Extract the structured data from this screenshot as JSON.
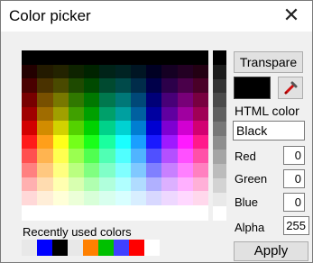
{
  "dialog": {
    "title": "Color picker",
    "close_glyph": "✕"
  },
  "palette": {
    "rows": [
      [
        "#000000",
        "#000000",
        "#000000",
        "#000000",
        "#000000",
        "#000000",
        "#000000",
        "#000000",
        "#000000",
        "#000000",
        "#000000",
        "#000000"
      ],
      [
        "#230000",
        "#231a00",
        "#232300",
        "#0e2300",
        "#002300",
        "#002318",
        "#002323",
        "#001523",
        "#000023",
        "#150023",
        "#230023",
        "#230013"
      ],
      [
        "#4a0000",
        "#4a3200",
        "#4a4a00",
        "#1e4a00",
        "#004a00",
        "#004a30",
        "#004a4a",
        "#002c4a",
        "#00004a",
        "#2c004a",
        "#4a004a",
        "#4a0028"
      ],
      [
        "#780000",
        "#785000",
        "#787800",
        "#307800",
        "#007800",
        "#00784e",
        "#007878",
        "#004878",
        "#000078",
        "#480078",
        "#780078",
        "#780040"
      ],
      [
        "#a00000",
        "#a06c00",
        "#a0a000",
        "#40a000",
        "#00a000",
        "#00a06a",
        "#00a0a0",
        "#0060a0",
        "#0000a0",
        "#6000a0",
        "#a000a0",
        "#a00056"
      ],
      [
        "#d20000",
        "#d28c00",
        "#d2d200",
        "#54d200",
        "#00d200",
        "#00d28a",
        "#00d2d2",
        "#007ed2",
        "#0000d2",
        "#7e00d2",
        "#d200d2",
        "#d20072"
      ],
      [
        "#ff1a1a",
        "#ff9f1a",
        "#ffff1a",
        "#74ff1a",
        "#1aff1a",
        "#1aff9f",
        "#1affff",
        "#1a9fff",
        "#1a1aff",
        "#9f1aff",
        "#ff1aff",
        "#ff1a8c"
      ],
      [
        "#ff5050",
        "#ffb450",
        "#ffff50",
        "#9aff50",
        "#50ff50",
        "#50ffb4",
        "#50ffff",
        "#50b4ff",
        "#5050ff",
        "#b450ff",
        "#ff50ff",
        "#ff50a8"
      ],
      [
        "#ff8080",
        "#ffc880",
        "#ffff80",
        "#baff80",
        "#80ff80",
        "#80ffc8",
        "#80ffff",
        "#80c8ff",
        "#8080ff",
        "#c880ff",
        "#ff80ff",
        "#ff80c0"
      ],
      [
        "#ffb0b0",
        "#ffdcb0",
        "#ffffb0",
        "#d8ffb0",
        "#b0ffb0",
        "#b0ffdc",
        "#b0ffff",
        "#b0dcff",
        "#b0b0ff",
        "#dcb0ff",
        "#ffb0ff",
        "#ffb0d8"
      ],
      [
        "#ffd8d8",
        "#ffeed8",
        "#ffffd8",
        "#ecffd8",
        "#d8ffd8",
        "#d8ffee",
        "#d8ffff",
        "#d8eeff",
        "#d8d8ff",
        "#eed8ff",
        "#ffd8ff",
        "#ffd8ec"
      ]
    ],
    "grays": [
      "#000000",
      "#1c1c1c",
      "#333333",
      "#4a4a4a",
      "#606060",
      "#777777",
      "#8e8e8e",
      "#a5a5a5",
      "#bcbcbc",
      "#d3d3d3",
      "#e9e9e9",
      "#ffffff"
    ]
  },
  "recent": {
    "label": "Recently used colors",
    "colors": [
      "#e8e8e8",
      "#0000ff",
      "#000000",
      "#e8e8e8",
      "#ff8000",
      "#00c000",
      "#4040ff",
      "#ff0000",
      "#ffffff"
    ]
  },
  "controls": {
    "transparent_label": "Transpare",
    "current_color": "#000000",
    "eyedropper_icon": "eyedropper-icon",
    "html_label": "HTML color",
    "html_value": "Black",
    "red_label": "Red",
    "red_value": "0",
    "green_label": "Green",
    "green_value": "0",
    "blue_label": "Blue",
    "blue_value": "0",
    "alpha_label": "Alpha",
    "alpha_value": "255",
    "apply_label": "Apply"
  }
}
